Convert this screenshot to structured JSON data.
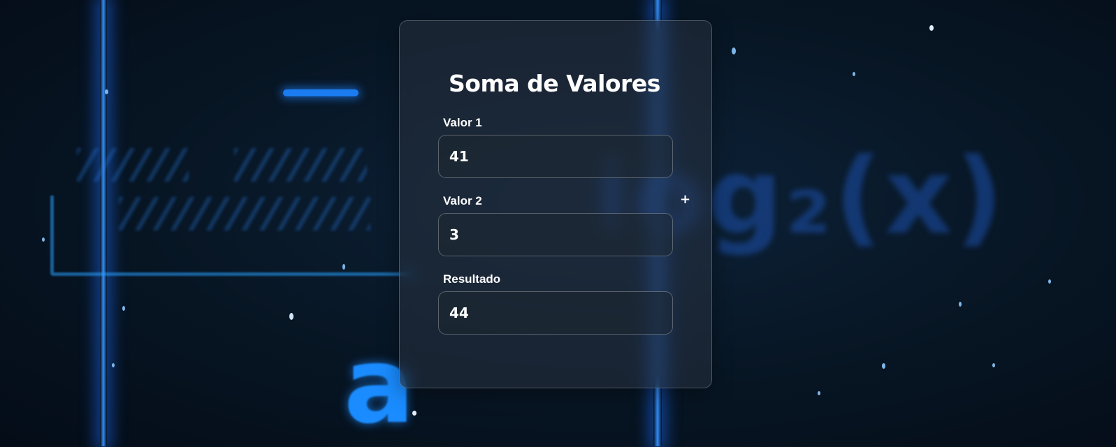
{
  "form": {
    "title": "Soma de Valores",
    "fields": [
      {
        "label": "Valor 1",
        "value": "41"
      },
      {
        "label": "Valor 2",
        "value": "3"
      },
      {
        "label": "Resultado",
        "value": "44"
      }
    ]
  },
  "operator": "+",
  "background": {
    "formula_text": "log₂(x)",
    "letter": "a",
    "accent_color": "#1a8cff",
    "base_color": "#071523"
  }
}
